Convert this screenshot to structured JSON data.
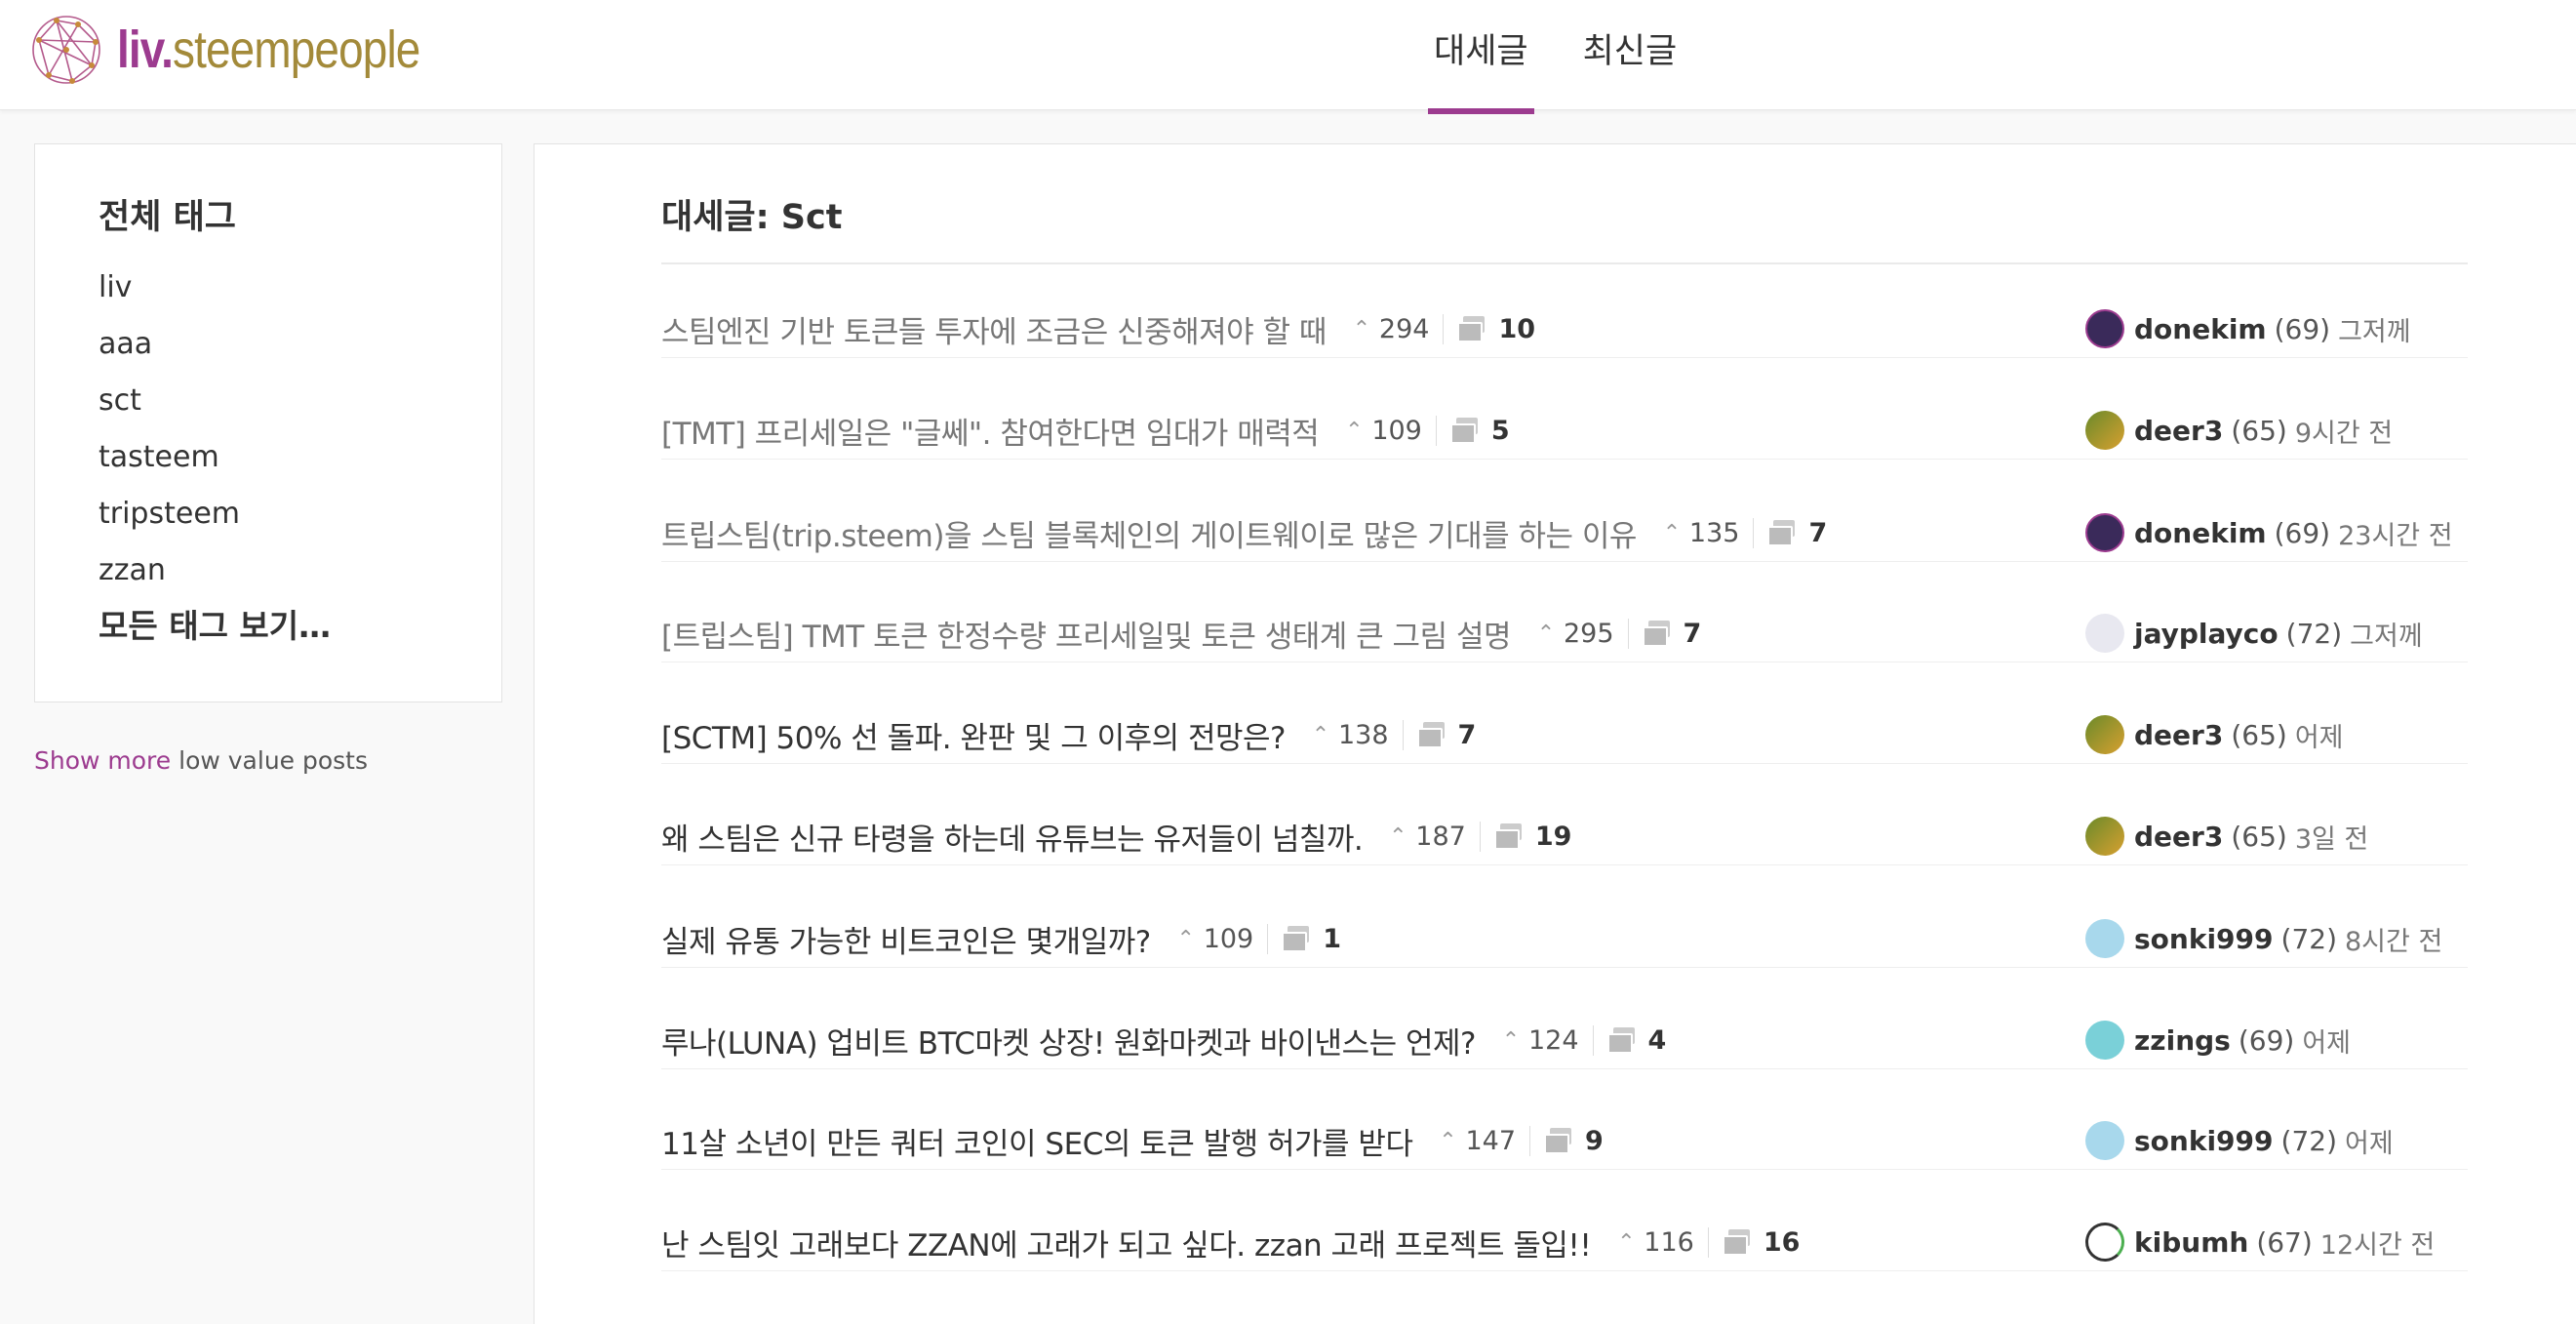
{
  "header": {
    "logo_liv": "liv",
    "logo_dot": ".",
    "logo_rest": "steempeople",
    "tabs": [
      {
        "label": "대세글",
        "active": true
      },
      {
        "label": "최신글",
        "active": false
      }
    ],
    "accent_color": "#9c3b8f"
  },
  "sidebar": {
    "title": "전체 태그",
    "tags": [
      "liv",
      "aaa",
      "sct",
      "tasteem",
      "tripsteem",
      "zzan"
    ],
    "all_tags_label": "모든 태그 보기…",
    "show_more_link": "Show more",
    "show_more_rest": "low value posts"
  },
  "main": {
    "title": "대세글: Sct",
    "posts": [
      {
        "title": "스팀엔진 기반 토큰들 투자에 조금은 신중해져야 할 때",
        "visited": true,
        "votes": "294",
        "comments": "10",
        "author": "donekim",
        "rep": "(69)",
        "time": "그저께",
        "avatar": "done"
      },
      {
        "title": "[TMT] 프리세일은 \"글쎄\". 참여한다면 임대가 매력적",
        "visited": true,
        "votes": "109",
        "comments": "5",
        "author": "deer3",
        "rep": "(65)",
        "time": "9시간 전",
        "avatar": "deer"
      },
      {
        "title": "트립스팀(trip.steem)을 스팀 블록체인의 게이트웨이로 많은 기대를 하는 이유",
        "visited": true,
        "votes": "135",
        "comments": "7",
        "author": "donekim",
        "rep": "(69)",
        "time": "23시간 전",
        "avatar": "done"
      },
      {
        "title": "[트립스팀] TMT 토큰 한정수량 프리세일및 토큰 생태계 큰 그림 설명",
        "visited": true,
        "votes": "295",
        "comments": "7",
        "author": "jayplayco",
        "rep": "(72)",
        "time": "그저께",
        "avatar": "jay"
      },
      {
        "title": "[SCTM] 50% 선 돌파. 완판 및 그 이후의 전망은?",
        "visited": false,
        "votes": "138",
        "comments": "7",
        "author": "deer3",
        "rep": "(65)",
        "time": "어제",
        "avatar": "deer"
      },
      {
        "title": "왜 스팀은 신규 타령을 하는데 유튜브는 유저들이 넘칠까.",
        "visited": false,
        "votes": "187",
        "comments": "19",
        "author": "deer3",
        "rep": "(65)",
        "time": "3일 전",
        "avatar": "deer"
      },
      {
        "title": "실제 유통 가능한 비트코인은 몇개일까?",
        "visited": false,
        "votes": "109",
        "comments": "1",
        "author": "sonki999",
        "rep": "(72)",
        "time": "8시간 전",
        "avatar": "sonki"
      },
      {
        "title": "루나(LUNA) 업비트 BTC마켓 상장! 원화마켓과 바이낸스는 언제?",
        "visited": false,
        "votes": "124",
        "comments": "4",
        "author": "zzings",
        "rep": "(69)",
        "time": "어제",
        "avatar": "zz"
      },
      {
        "title": "11살 소년이 만든 쿼터 코인이 SEC의 토큰 발행 허가를 받다",
        "visited": false,
        "votes": "147",
        "comments": "9",
        "author": "sonki999",
        "rep": "(72)",
        "time": "어제",
        "avatar": "sonki"
      },
      {
        "title": "난 스팀잇 고래보다 ZZAN에 고래가 되고 싶다. zzan 고래 프로젝트 돌입!!",
        "visited": false,
        "votes": "116",
        "comments": "16",
        "author": "kibumh",
        "rep": "(67)",
        "time": "12시간 전",
        "avatar": "kib"
      }
    ]
  },
  "icons": {
    "vote": "chevron-up-icon",
    "comment": "comment-icon"
  }
}
